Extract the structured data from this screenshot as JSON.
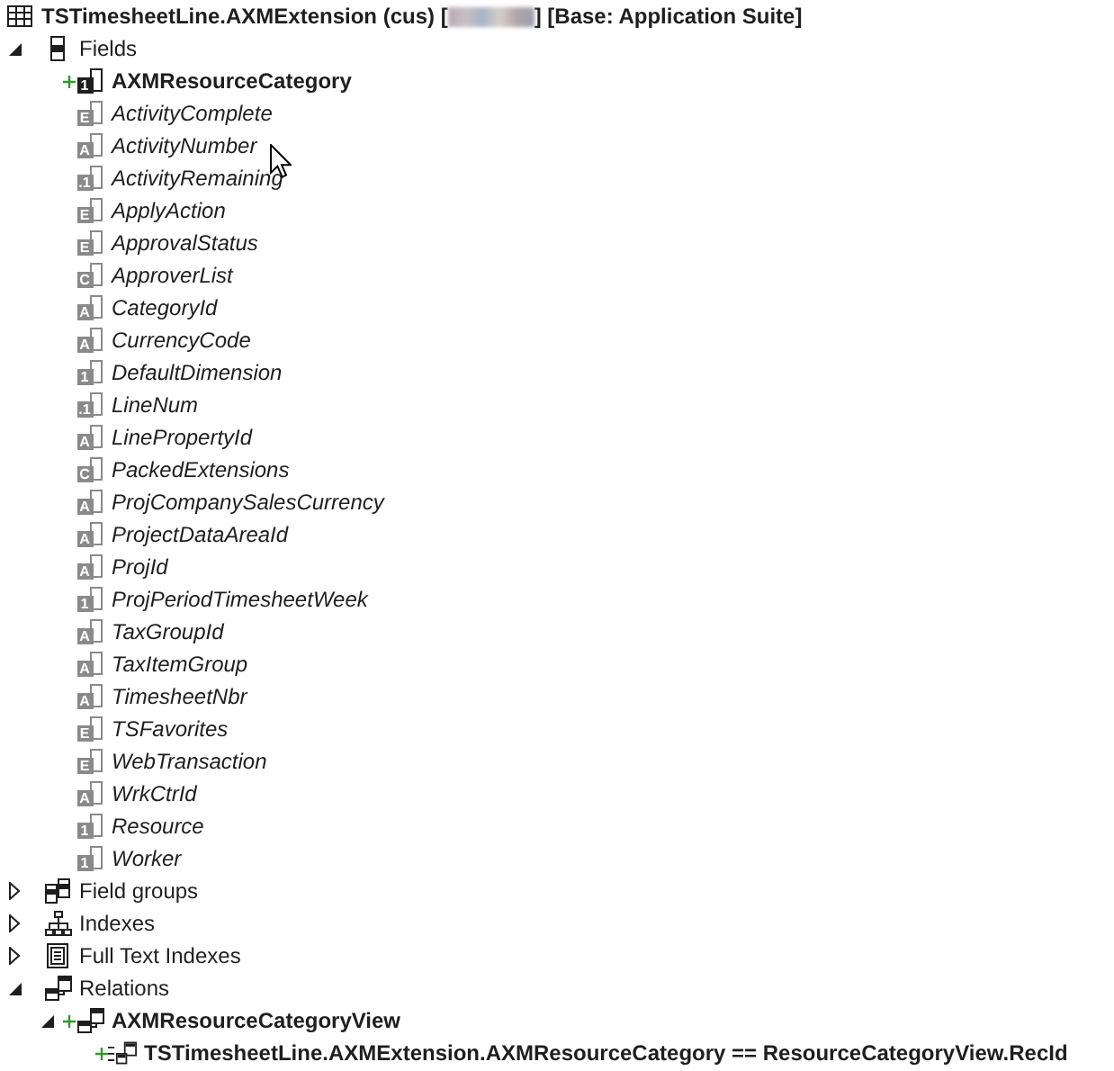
{
  "title": {
    "prefix": "TSTimesheetLine.AXMExtension (cus) [",
    "suffix": "] [Base: Application Suite]"
  },
  "tree": [
    {
      "label": "Fields",
      "kind": "fields",
      "expanded": true,
      "children": [
        {
          "label": "AXMResourceCategory",
          "kind": "field",
          "glyph": "1",
          "added": true
        },
        {
          "label": "ActivityComplete",
          "kind": "field",
          "glyph": "E",
          "added": false
        },
        {
          "label": "ActivityNumber",
          "kind": "field",
          "glyph": "A",
          "added": false
        },
        {
          "label": "ActivityRemaining",
          "kind": "field",
          "glyph": ".1",
          "added": false
        },
        {
          "label": "ApplyAction",
          "kind": "field",
          "glyph": "E",
          "added": false
        },
        {
          "label": "ApprovalStatus",
          "kind": "field",
          "glyph": "E",
          "added": false
        },
        {
          "label": "ApproverList",
          "kind": "field",
          "glyph": "C",
          "added": false
        },
        {
          "label": "CategoryId",
          "kind": "field",
          "glyph": "A",
          "added": false
        },
        {
          "label": "CurrencyCode",
          "kind": "field",
          "glyph": "A",
          "added": false
        },
        {
          "label": "DefaultDimension",
          "kind": "field",
          "glyph": "1",
          "added": false
        },
        {
          "label": "LineNum",
          "kind": "field",
          "glyph": ".1",
          "added": false
        },
        {
          "label": "LinePropertyId",
          "kind": "field",
          "glyph": "A",
          "added": false
        },
        {
          "label": "PackedExtensions",
          "kind": "field",
          "glyph": "C",
          "added": false
        },
        {
          "label": "ProjCompanySalesCurrency",
          "kind": "field",
          "glyph": "A",
          "added": false
        },
        {
          "label": "ProjectDataAreaId",
          "kind": "field",
          "glyph": "A",
          "added": false
        },
        {
          "label": "ProjId",
          "kind": "field",
          "glyph": "A",
          "added": false
        },
        {
          "label": "ProjPeriodTimesheetWeek",
          "kind": "field",
          "glyph": "1",
          "added": false
        },
        {
          "label": "TaxGroupId",
          "kind": "field",
          "glyph": "A",
          "added": false
        },
        {
          "label": "TaxItemGroup",
          "kind": "field",
          "glyph": "A",
          "added": false
        },
        {
          "label": "TimesheetNbr",
          "kind": "field",
          "glyph": "A",
          "added": false
        },
        {
          "label": "TSFavorites",
          "kind": "field",
          "glyph": "E",
          "added": false
        },
        {
          "label": "WebTransaction",
          "kind": "field",
          "glyph": "E",
          "added": false
        },
        {
          "label": "WrkCtrId",
          "kind": "field",
          "glyph": "A",
          "added": false
        },
        {
          "label": "Resource",
          "kind": "field",
          "glyph": "1",
          "added": false
        },
        {
          "label": "Worker",
          "kind": "field",
          "glyph": "1",
          "added": false
        }
      ]
    },
    {
      "label": "Field groups",
      "kind": "field_groups",
      "expanded": false
    },
    {
      "label": "Indexes",
      "kind": "indexes",
      "expanded": false
    },
    {
      "label": "Full Text Indexes",
      "kind": "fulltext_indexes",
      "expanded": false
    },
    {
      "label": "Relations",
      "kind": "relations",
      "expanded": true,
      "children": [
        {
          "label": "AXMResourceCategoryView",
          "kind": "relation",
          "added": true,
          "expanded": true,
          "children": [
            {
              "label": "TSTimesheetLine.AXMExtension.AXMResourceCategory == ResourceCategoryView.RecId",
              "kind": "constraint",
              "added": true
            }
          ]
        }
      ]
    }
  ]
}
